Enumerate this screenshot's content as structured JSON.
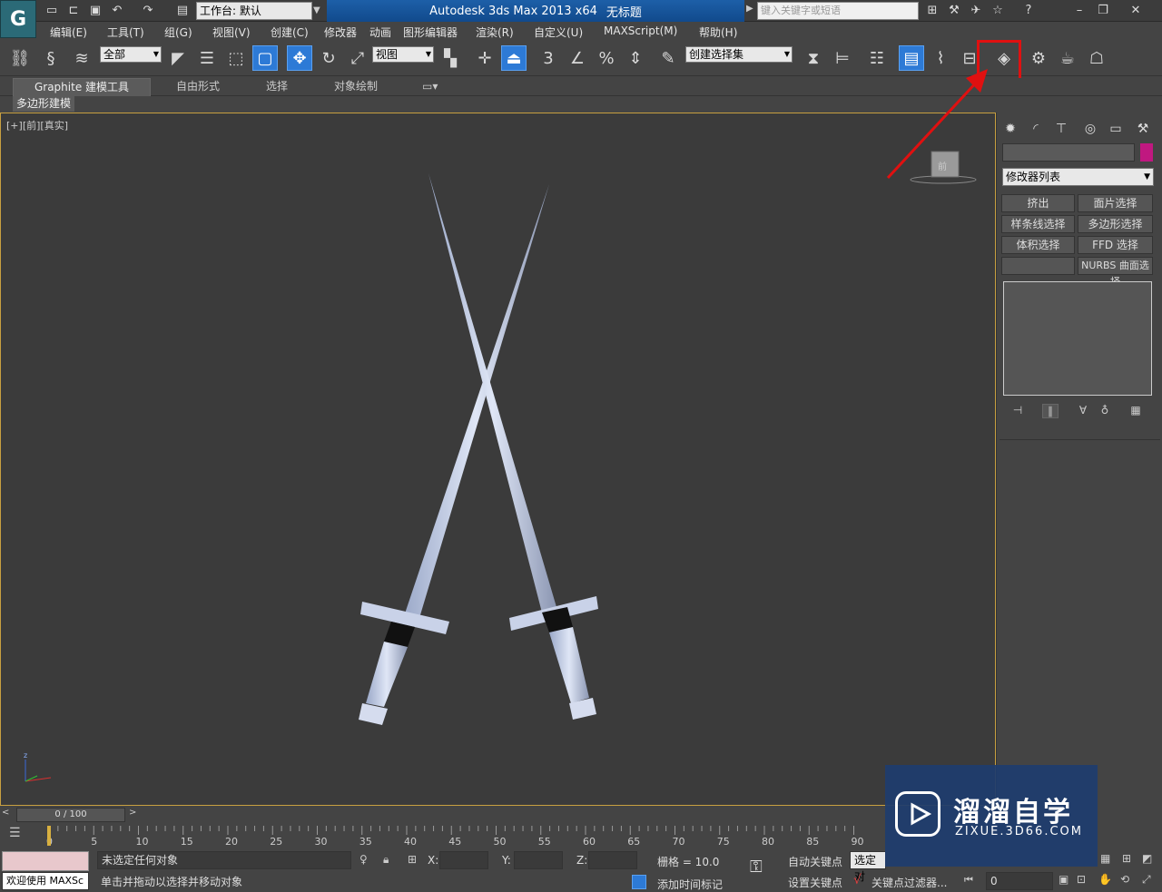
{
  "titlebar": {
    "workspace_label": "工作台: 默认",
    "app_name": "Autodesk 3ds Max  2013 x64",
    "doc_name": "无标题",
    "search_placeholder": "键入关键字或短语"
  },
  "menu": [
    "编辑(E)",
    "工具(T)",
    "组(G)",
    "视图(V)",
    "创建(C)",
    "修改器",
    "动画",
    "图形编辑器",
    "渲染(R)",
    "自定义(U)",
    "MAXScript(M)",
    "帮助(H)"
  ],
  "toolbar": {
    "filter_value": "全部",
    "refcoord_value": "视图",
    "selection_set_value": "创建选择集"
  },
  "ribbon": {
    "tabs": [
      "Graphite 建模工具",
      "自由形式",
      "选择",
      "对象绘制"
    ],
    "sub_tab": "多边形建模"
  },
  "viewport": {
    "label_plus": "[+]",
    "label_view": "[前]",
    "label_shading": "[真实]",
    "viewcube_face": "前"
  },
  "panel": {
    "modifier_list": "修改器列表",
    "buttons": [
      "挤出",
      "面片选择",
      "样条线选择",
      "多边形选择",
      "体积选择",
      "FFD 选择",
      "",
      "NURBS 曲面选择"
    ]
  },
  "timeline": {
    "frame_display": "0 / 100",
    "ticks": [
      "0",
      "5",
      "10",
      "15",
      "20",
      "25",
      "30",
      "35",
      "40",
      "45",
      "50",
      "55",
      "60",
      "65",
      "70",
      "75",
      "80",
      "85",
      "90"
    ]
  },
  "status": {
    "welcome": "欢迎使用 MAXSc",
    "selection_status": "未选定任何对象",
    "prompt": "单击并拖动以选择并移动对象",
    "x_label": "X:",
    "y_label": "Y:",
    "z_label": "Z:",
    "grid": "栅格 = 10.0",
    "add_time_tag": "添加时间标记",
    "auto_key": "自动关键点",
    "selected_dropdown": "选定对",
    "set_key": "设置关键点",
    "key_filters": "关键点过滤器...",
    "frame_value": "0"
  },
  "watermark": {
    "title": "溜溜自学",
    "url": "ZIXUE.3D66.COM"
  },
  "colors": {
    "highlight": "#e01010",
    "accent": "#2d7ad6",
    "viewport_border": "#c8a040",
    "object_color": "#c01880"
  }
}
